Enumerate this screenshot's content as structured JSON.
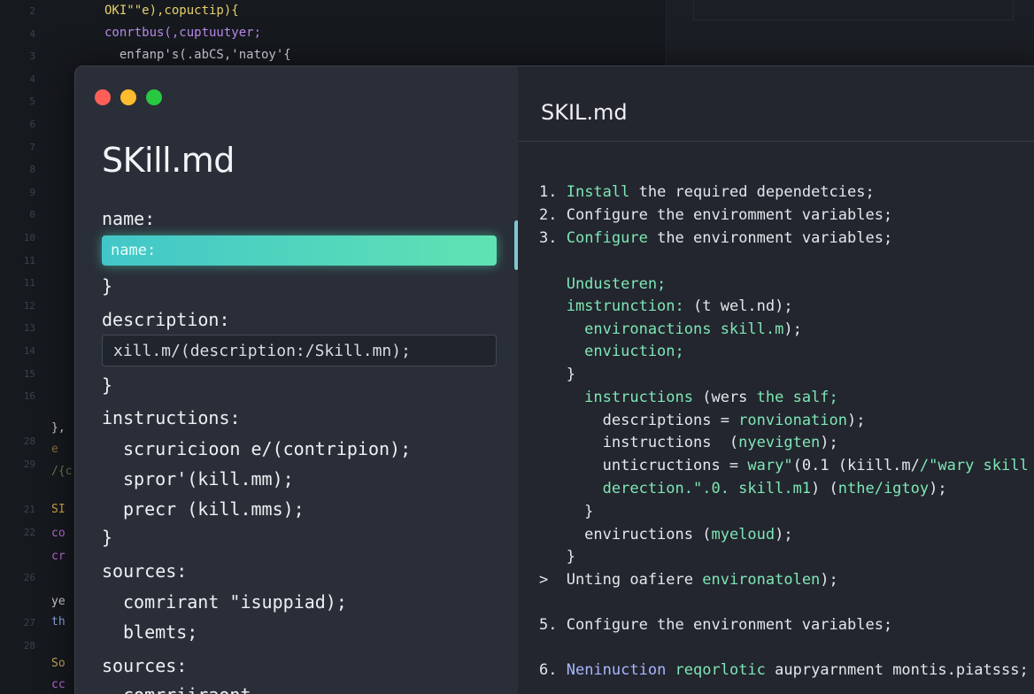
{
  "background": {
    "gutter_numbers": [
      "2",
      "4",
      "3",
      "4",
      "5",
      "6",
      "7",
      "8",
      "9",
      "0",
      "10",
      "11",
      "11",
      "12",
      "13",
      "14",
      "15",
      "16",
      "",
      "28",
      "29",
      "",
      "21",
      "22",
      "",
      "26",
      "",
      "27",
      "28"
    ],
    "code_lines": [
      {
        "text": "OKI\"\"e),copuctip){",
        "color": "#e6d06a"
      },
      {
        "text": "conrtbus(,cuptuutyer;",
        "color": "#b98ae8"
      },
      {
        "text": "  enfanp's(.abCS,'natoy'{",
        "color": "#d7dbe3"
      }
    ],
    "left_fragments": [
      {
        "text": "},",
        "color": "#c9ccd3"
      },
      {
        "text": "e",
        "color": "#8b6d3c"
      },
      {
        "text": "/{c",
        "color": "#6a7a50"
      },
      {
        "text": "SI",
        "color": "#d9a24a"
      },
      {
        "text": "co",
        "color": "#b86bd4"
      },
      {
        "text": "cr",
        "color": "#b86bd4"
      },
      {
        "text": "ye",
        "color": "#c9ccd3"
      },
      {
        "text": "th",
        "color": "#8aa7e0"
      },
      {
        "text": "So",
        "color": "#c5a25a"
      },
      {
        "text": "cc",
        "color": "#b86bd4"
      }
    ]
  },
  "window": {
    "traffic_lights": {
      "close": "#ff5f57",
      "minimize": "#febc2e",
      "maximize": "#28c840"
    },
    "left": {
      "title": "SKill.md",
      "name_label": "name:",
      "name_field_value": "name:",
      "brace_close_1": "}",
      "description_label": "description:",
      "description_field_value": "xill.m/(description:∕Skill.mn);",
      "brace_close_2": "}",
      "instructions_label": "instructions:",
      "instruction_lines": [
        "scruricioon e/(contripion);",
        "spror'(kill.mm);",
        "precr (kill.mms);"
      ],
      "brace_close_3": "}",
      "sources_label": "sources:",
      "source_lines": [
        "comrirant \"isuppiad);",
        "blemts;"
      ],
      "sources_label_2": "sources:",
      "trailing_line": "comrriiraont."
    },
    "right": {
      "title": "SKIL.md",
      "lines": [
        {
          "segments": [
            {
              "t": "1. ",
              "c": "cw"
            },
            {
              "t": "Install",
              "c": "cg"
            },
            {
              "t": " the required dependetcies;",
              "c": "cw"
            }
          ]
        },
        {
          "segments": [
            {
              "t": "2. Configure the enviromment variables;",
              "c": "cw"
            }
          ]
        },
        {
          "segments": [
            {
              "t": "3. ",
              "c": "cw"
            },
            {
              "t": "Configure",
              "c": "cg"
            },
            {
              "t": " the environment variables;",
              "c": "cw"
            }
          ]
        },
        {
          "segments": [
            {
              "t": "   Undusteren;",
              "c": "cg"
            }
          ]
        },
        {
          "segments": [
            {
              "t": "   imstrunction: ",
              "c": "cg"
            },
            {
              "t": "(t wel.nd);",
              "c": "cw"
            }
          ]
        },
        {
          "segments": [
            {
              "t": "     environactions skill.m",
              "c": "cg"
            },
            {
              "t": ");",
              "c": "cw"
            }
          ]
        },
        {
          "segments": [
            {
              "t": "     enviuction;",
              "c": "cg"
            }
          ]
        },
        {
          "segments": [
            {
              "t": "   }",
              "c": "cw"
            }
          ]
        },
        {
          "segments": [
            {
              "t": "     instructions",
              "c": "cg"
            },
            {
              "t": " (wers ",
              "c": "cw"
            },
            {
              "t": "the salf;",
              "c": "cg"
            }
          ]
        },
        {
          "segments": [
            {
              "t": "       descriptions = ",
              "c": "cw"
            },
            {
              "t": "ronvionation",
              "c": "cg"
            },
            {
              "t": ");",
              "c": "cw"
            }
          ]
        },
        {
          "segments": [
            {
              "t": "       instructions  (",
              "c": "cw"
            },
            {
              "t": "nyevigten",
              "c": "cg"
            },
            {
              "t": ");",
              "c": "cw"
            }
          ]
        },
        {
          "segments": [
            {
              "t": "       unticructions = ",
              "c": "cw"
            },
            {
              "t": "wary\"",
              "c": "cg"
            },
            {
              "t": "(0.1 (kiill.m/",
              "c": "cw"
            },
            {
              "t": "∕\"wary skill",
              "c": "cg"
            }
          ]
        },
        {
          "segments": [
            {
              "t": "       derection.\".0. skill.m1",
              "c": "cg"
            },
            {
              "t": ") (",
              "c": "cw"
            },
            {
              "t": "nthe/igtoy",
              "c": "cg"
            },
            {
              "t": ");",
              "c": "cw"
            }
          ]
        },
        {
          "segments": [
            {
              "t": "     }",
              "c": "cw"
            }
          ]
        },
        {
          "segments": [
            {
              "t": "     enviructions (",
              "c": "cw"
            },
            {
              "t": "myeloud",
              "c": "cg"
            },
            {
              "t": ");",
              "c": "cw"
            }
          ]
        },
        {
          "segments": [
            {
              "t": "   }",
              "c": "cw"
            }
          ]
        },
        {
          "segments": [
            {
              "t": ">  Unting oafiere ",
              "c": "cw"
            },
            {
              "t": "environatolen",
              "c": "cg"
            },
            {
              "t": ");",
              "c": "cw"
            }
          ]
        },
        {
          "segments": [
            {
              "t": "5. Configure the environment variables;",
              "c": "cw"
            }
          ]
        },
        {
          "segments": [
            {
              "t": "6. ",
              "c": "cw"
            },
            {
              "t": "Neninuction ",
              "c": "cb"
            },
            {
              "t": "reqorlotic ",
              "c": "cg"
            },
            {
              "t": "aupryarnment montis.piatsss;",
              "c": "cw"
            }
          ]
        }
      ]
    }
  }
}
